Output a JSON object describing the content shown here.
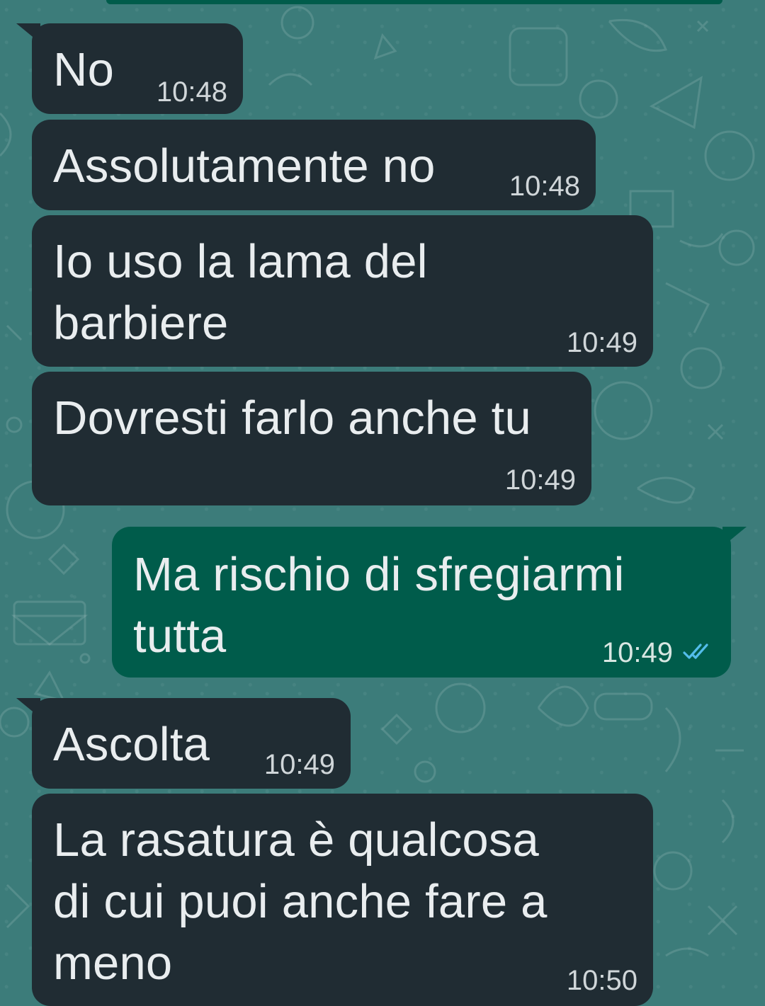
{
  "messages": [
    {
      "direction": "incoming",
      "text": "No",
      "time": "10:48"
    },
    {
      "direction": "incoming",
      "text": "Assolutamente no",
      "time": "10:48"
    },
    {
      "direction": "incoming",
      "text": "Io uso la lama del\nbarbiere",
      "time": "10:49"
    },
    {
      "direction": "incoming",
      "text": "Dovresti farlo anche tu",
      "time": "10:49"
    },
    {
      "direction": "outgoing",
      "text": "Ma rischio di sfregiarmi\ntutta",
      "time": "10:49",
      "status_icon": "double-check-read-icon"
    },
    {
      "direction": "incoming",
      "text": "Ascolta",
      "time": "10:49"
    },
    {
      "direction": "incoming",
      "text": "La rasatura è qualcosa\ndi cui puoi anche fare a\nmeno",
      "time": "10:50"
    }
  ],
  "colors": {
    "wallpaper": "#3c7c7a",
    "incoming_bubble": "#202c33",
    "outgoing_bubble": "#005c4b",
    "message_text": "#e9edef",
    "read_ticks": "#53bdeb"
  }
}
